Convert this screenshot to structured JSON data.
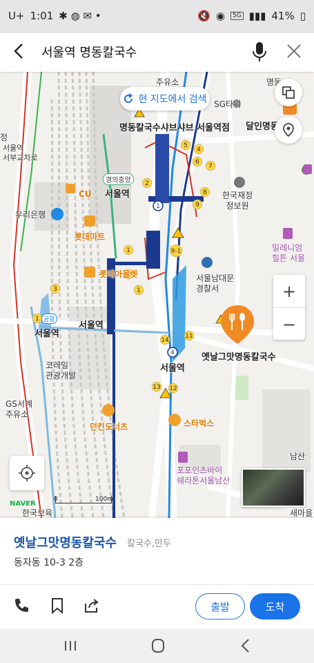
{
  "status": {
    "carrier": "U+",
    "time": "1:01",
    "battery": "41%",
    "network": "5G"
  },
  "search": {
    "query": "서울역 명동칼국수"
  },
  "map": {
    "research_label": "현 지도에서 검색",
    "labels": {
      "restaurant_shabu": "명동칼국수샤브샤브 서울역점",
      "sg_tower": "SG타워",
      "dalin": "달인명동",
      "gyeongui": "경의중앙",
      "seoul_station_top": "서울역",
      "cu": "CU",
      "lotte_mart": "롯데마트",
      "lotte_outlet": "롯데아울렛",
      "woori": "우리은행",
      "gongang": "공항",
      "seoul_station_left": "서울역",
      "seoul_station_center": "서울역",
      "korail": "코레일\n관광개발",
      "gs": "GS서계\n주유소",
      "dunkin": "던킨도너츠",
      "seoul_station_bottom": "서울역",
      "finance": "한국재정\n정보원",
      "millennium": "밀레니엄\n힐튼 서울",
      "namdaemun": "서울남대문\n경찰서",
      "target": "옛날그맛명동칼국수",
      "starbucks": "스타벅스",
      "fourpoints": "포포인츠바이\n쉐라톤서울남산",
      "seomaeul": "새마을",
      "hanguk": "한국보육",
      "juyuso": "주유소",
      "seobu": "서울역\n서부교차로",
      "jeong": "정",
      "myeong": "명동",
      "nasan": "남산"
    },
    "scale": {
      "left": "0",
      "right": "100m"
    },
    "naver_logo": "NAVER"
  },
  "place": {
    "name": "옛날그맛명동칼국수",
    "category": "칼국수,만두",
    "address": "동자동 10-3 2층",
    "depart_label": "출발",
    "arrive_label": "도착"
  },
  "colors": {
    "accent": "#1a73e8",
    "poi_orange": "#f08a24",
    "subway_blue": "#1b3a8f"
  }
}
